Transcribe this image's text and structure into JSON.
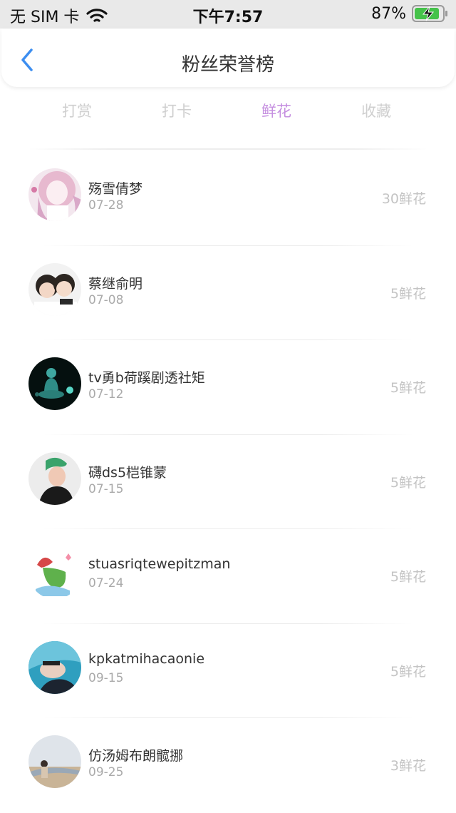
{
  "status_bar": {
    "carrier": "无 SIM 卡",
    "time": "下午7:57",
    "battery": "87%"
  },
  "nav": {
    "title": "粉丝荣誉榜"
  },
  "tabs": [
    {
      "label": "打赏"
    },
    {
      "label": "打卡"
    },
    {
      "label": "鲜花"
    },
    {
      "label": "收藏"
    }
  ],
  "active_tab": "鲜花",
  "fans": [
    {
      "name": "殇雪倩梦",
      "date": "07-28",
      "count": "30鲜花"
    },
    {
      "name": "蔡继俞明",
      "date": "07-08",
      "count": "5鲜花"
    },
    {
      "name": "tv勇b荷蹊剧透社矩",
      "date": "07-12",
      "count": "5鲜花"
    },
    {
      "name": "礴ds5桤锥蒙",
      "date": "07-15",
      "count": "5鲜花"
    },
    {
      "name": "stuasriqtewepitzman",
      "date": "07-24",
      "count": "5鲜花"
    },
    {
      "name": "kpkatmihacaonie",
      "date": "09-15",
      "count": "5鲜花"
    },
    {
      "name": "仿汤姆布朗髋挪",
      "date": "09-25",
      "count": "3鲜花"
    }
  ],
  "colors": {
    "accent": "#c58fe0",
    "back_icon": "#3d8ef0",
    "inactive_tab": "#cfcfcf"
  }
}
